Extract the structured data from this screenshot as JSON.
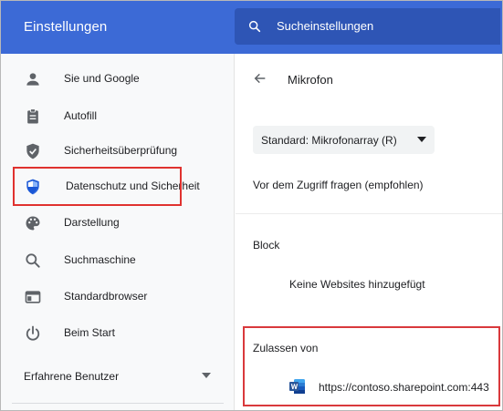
{
  "header": {
    "title": "Einstellungen",
    "search_placeholder": "Sucheinstellungen"
  },
  "sidebar": {
    "items": [
      {
        "label": "Sie und Google",
        "icon": "person-icon"
      },
      {
        "label": "Autofill",
        "icon": "clipboard-icon"
      },
      {
        "label": "Sicherheitsüberprüfung",
        "icon": "shield-check-icon"
      },
      {
        "label": "Datenschutz und Sicherheit",
        "icon": "privacy-shield-icon",
        "active": true
      },
      {
        "label": "Darstellung",
        "icon": "palette-icon"
      },
      {
        "label": "Suchmaschine",
        "icon": "search-icon"
      },
      {
        "label": "Standardbrowser",
        "icon": "browser-icon"
      },
      {
        "label": "Beim Start",
        "icon": "power-icon"
      }
    ],
    "advanced_label": "Erfahrene Benutzer"
  },
  "main": {
    "title": "Mikrofon",
    "mic_select_value": "Standard: Mikrofonarray (R)",
    "ask_option": "Vor dem Zugriff fragen (empfohlen)",
    "block_title": "Block",
    "block_empty": "Keine Websites hinzugefügt",
    "allow_title": "Zulassen von",
    "allowed_sites": [
      {
        "url": "https://contoso.sharepoint.com:443",
        "icon": "word-icon"
      }
    ]
  },
  "colors": {
    "header_bg": "#3c6ad6",
    "search_bg": "#2e55b5",
    "active_icon": "#1a57d6",
    "highlight_red": "#e0322f",
    "word_blue": "#2b579a"
  }
}
